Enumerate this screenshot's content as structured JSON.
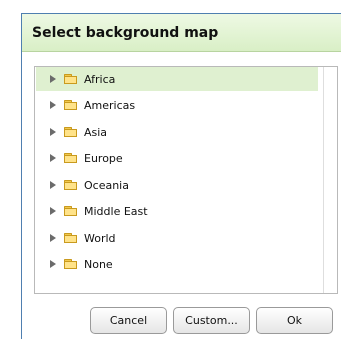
{
  "dialog": {
    "title": "Select background map"
  },
  "tree": {
    "items": [
      {
        "label": "Africa",
        "selected": true
      },
      {
        "label": "Americas",
        "selected": false
      },
      {
        "label": "Asia",
        "selected": false
      },
      {
        "label": "Europe",
        "selected": false
      },
      {
        "label": "Oceania",
        "selected": false
      },
      {
        "label": "Middle East",
        "selected": false
      },
      {
        "label": "World",
        "selected": false
      },
      {
        "label": "None",
        "selected": false
      }
    ]
  },
  "buttons": {
    "cancel_label": "Cancel",
    "custom_label": "Custom...",
    "ok_label": "Ok"
  },
  "icons": {
    "expand": "triangle-right-icon",
    "folder": "folder-icon"
  },
  "colors": {
    "header_bg": "#d9efc6",
    "selected_row": "#dff0d0",
    "dialog_border": "#4f7fb0",
    "folder": "#ffe38a"
  }
}
